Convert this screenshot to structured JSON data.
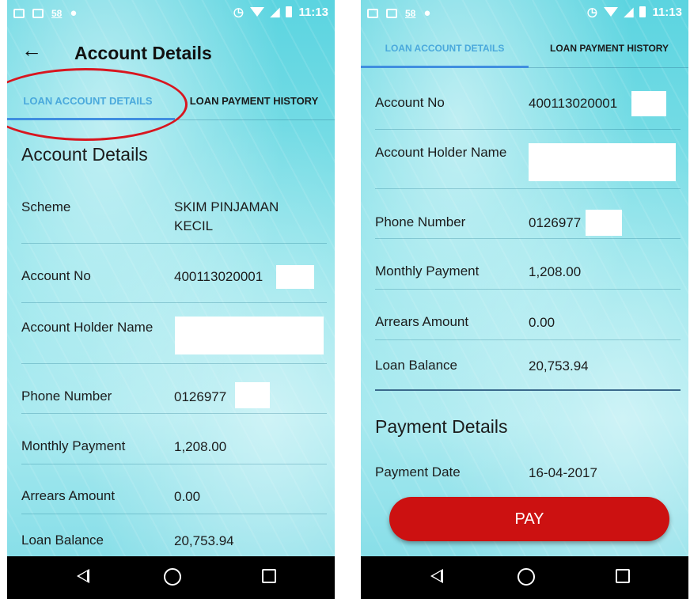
{
  "status_bar": {
    "badge": "58",
    "time": "11:13"
  },
  "left": {
    "title": "Account Details",
    "tabs": [
      {
        "label": "LOAN ACCOUNT DETAILS",
        "active": true
      },
      {
        "label": "LOAN PAYMENT HISTORY",
        "active": false
      }
    ],
    "section_title": "Account Details",
    "rows": [
      {
        "label": "Scheme",
        "value": "SKIM PINJAMAN KECIL"
      },
      {
        "label": "Account No",
        "value": "400113020001"
      },
      {
        "label": "Account Holder Name",
        "value": ""
      },
      {
        "label": "Phone Number",
        "value": "0126977"
      },
      {
        "label": "Monthly Payment",
        "value": "1,208.00"
      },
      {
        "label": "Arrears Amount",
        "value": "0.00"
      },
      {
        "label": "Loan Balance",
        "value": "20,753.94"
      }
    ]
  },
  "right": {
    "tabs": [
      {
        "label": "LOAN ACCOUNT DETAILS",
        "active": true
      },
      {
        "label": "LOAN PAYMENT HISTORY",
        "active": false
      }
    ],
    "rows": [
      {
        "label": "Account No",
        "value": "400113020001"
      },
      {
        "label": "Account Holder Name",
        "value": ""
      },
      {
        "label": "Phone Number",
        "value": "0126977"
      },
      {
        "label": "Monthly Payment",
        "value": "1,208.00"
      },
      {
        "label": "Arrears Amount",
        "value": "0.00"
      },
      {
        "label": "Loan Balance",
        "value": "20,753.94"
      }
    ],
    "payment_section_title": "Payment Details",
    "payment_rows": [
      {
        "label": "Payment Date",
        "value": "16-04-2017"
      }
    ],
    "pay_label": "PAY"
  },
  "colors": {
    "accent_tab": "#4aa9dc",
    "pay_button": "#cc1111",
    "highlight": "#d8161f"
  },
  "icons": [
    "back-arrow-icon",
    "alarm-icon",
    "wifi-icon",
    "signal-icon",
    "battery-icon",
    "nav-back-icon",
    "nav-home-icon",
    "nav-recent-icon"
  ]
}
